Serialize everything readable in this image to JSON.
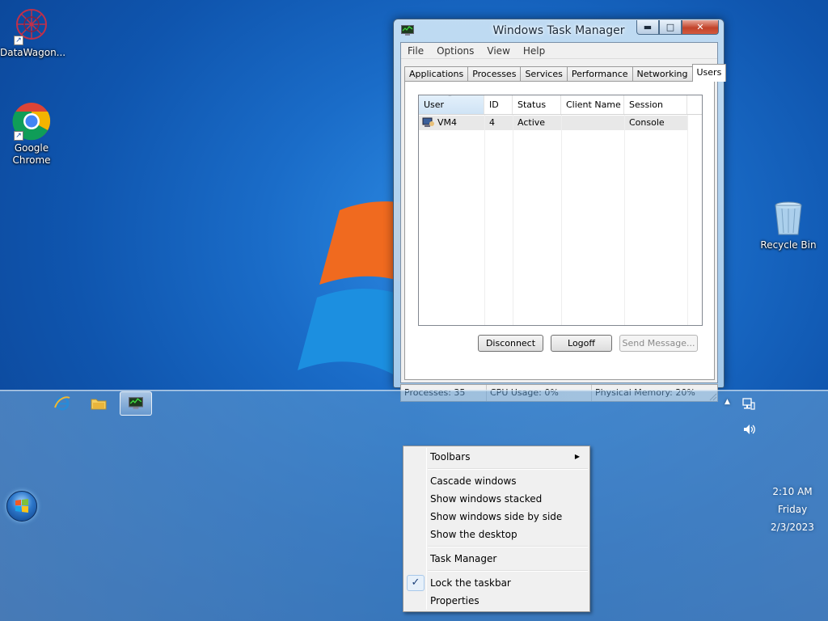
{
  "desktop": {
    "icons": [
      {
        "label": "DataWagon...",
        "icon": "datawagon-icon"
      },
      {
        "label": "Google Chrome",
        "icon": "chrome-icon"
      },
      {
        "label": "Recycle Bin",
        "icon": "recycle-bin-icon"
      }
    ],
    "shortcut_glyph": "↗"
  },
  "window": {
    "title": "Windows Task Manager",
    "controls": {
      "minimize": "▬",
      "maximize": "□",
      "close": "✕"
    },
    "menu": [
      "File",
      "Options",
      "View",
      "Help"
    ],
    "tabs": [
      "Applications",
      "Processes",
      "Services",
      "Performance",
      "Networking",
      "Users"
    ],
    "active_tab": "Users",
    "users_table": {
      "columns": [
        "User",
        "ID",
        "Status",
        "Client Name",
        "Session"
      ],
      "sort_glyph": "ˆ",
      "rows": [
        {
          "user": "VM4",
          "id": "4",
          "status": "Active",
          "client_name": "",
          "session": "Console"
        }
      ]
    },
    "buttons": {
      "disconnect": "Disconnect",
      "logoff": "Logoff",
      "send_message": "Send Message..."
    },
    "status": {
      "processes": "Processes: 35",
      "cpu": "CPU Usage: 0%",
      "memory": "Physical Memory: 20%"
    }
  },
  "taskbar": {
    "pinned": [
      {
        "name": "internet-explorer-icon"
      },
      {
        "name": "file-explorer-icon"
      },
      {
        "name": "task-manager-icon",
        "active": true
      }
    ],
    "tray": {
      "up_arrow": "▲"
    },
    "clock": {
      "time": "2:10 AM",
      "day": "Friday",
      "date": "2/3/2023"
    }
  },
  "context_menu": {
    "toolbars": "Toolbars",
    "submenu_arrow": "▶",
    "cascade": "Cascade windows",
    "stacked": "Show windows stacked",
    "side_by_side": "Show windows side by side",
    "show_desktop": "Show the desktop",
    "task_manager": "Task Manager",
    "lock_taskbar": "Lock the taskbar",
    "lock_checked_glyph": "✓",
    "properties": "Properties"
  }
}
